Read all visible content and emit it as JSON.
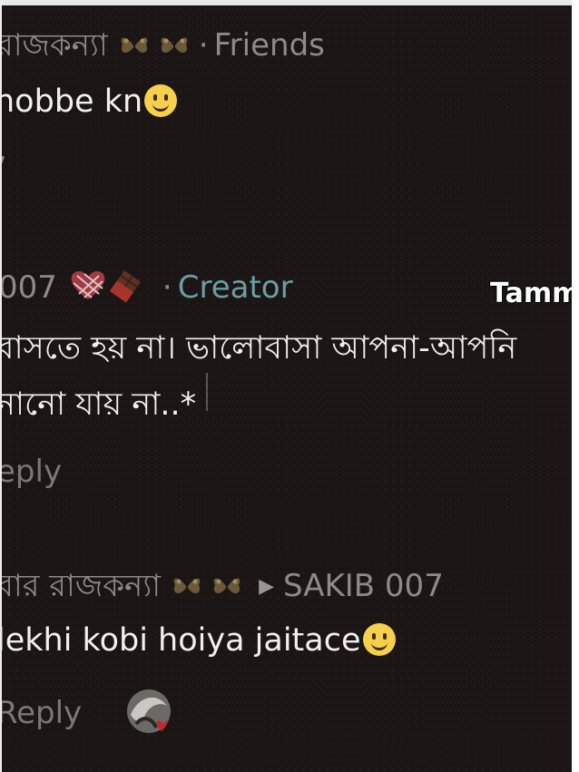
{
  "comments": [
    {
      "author": "রাজকন্যা",
      "relation": "Friends",
      "text": "nobbe kn",
      "stub": "7"
    },
    {
      "author": "007",
      "relation": "Creator",
      "text_line1": "বাসতে হয় না। ভালোবাসা আপনা-আপনি",
      "text_line2": "নানো যায় না..*",
      "reply": "eply"
    },
    {
      "author": "বার রাজকন্যা",
      "reply_to": "SAKIB 007",
      "text": "lekhi kobi hoiya jaitace",
      "reply": "Reply"
    }
  ],
  "watermark": "Tamm",
  "colors": {
    "background": "#1b1615",
    "creator": "#6a9ea3",
    "meta": "#8f8a88",
    "emoji": "#f6d04d"
  }
}
